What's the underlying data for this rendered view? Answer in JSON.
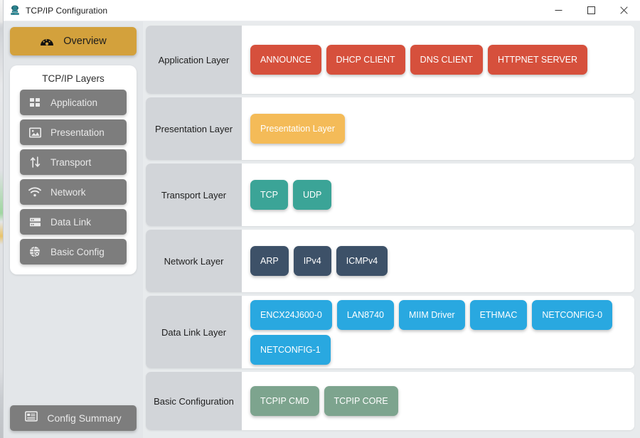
{
  "window": {
    "title": "TCP/IP Configuration",
    "icon": "network-stack-icon",
    "controls": {
      "minimize": "minimize-icon",
      "maximize": "maximize-icon",
      "close": "close-icon"
    }
  },
  "sidebar": {
    "overview": {
      "label": "Overview",
      "icon": "dashboard-gauge-icon",
      "color": "#d3a13c"
    },
    "layers_title": "TCP/IP Layers",
    "items": [
      {
        "label": "Application",
        "icon": "grid-squares-icon"
      },
      {
        "label": "Presentation",
        "icon": "image-picture-icon"
      },
      {
        "label": "Transport",
        "icon": "up-down-arrows-icon"
      },
      {
        "label": "Network",
        "icon": "wifi-signal-icon"
      },
      {
        "label": "Data Link",
        "icon": "server-rack-icon"
      },
      {
        "label": "Basic Config",
        "icon": "globe-gear-icon"
      }
    ],
    "summary": {
      "label": "Config Summary",
      "icon": "list-panel-icon"
    }
  },
  "main": {
    "rows": [
      {
        "label": "Application Layer",
        "color": "#d6503c",
        "chips": [
          "ANNOUNCE",
          "DHCP CLIENT",
          "DNS CLIENT",
          "HTTPNET SERVER"
        ]
      },
      {
        "label": "Presentation Layer",
        "color": "#f4bb58",
        "chips": [
          "Presentation Layer"
        ]
      },
      {
        "label": "Transport Layer",
        "color": "#3ba497",
        "chips": [
          "TCP",
          "UDP"
        ]
      },
      {
        "label": "Network Layer",
        "color": "#3d5168",
        "chips": [
          "ARP",
          "IPv4",
          "ICMPv4"
        ]
      },
      {
        "label": "Data Link Layer",
        "color": "#29a8e0",
        "chips": [
          "ENCX24J600-0",
          "LAN8740",
          "MIIM Driver",
          "ETHMAC",
          "NETCONFIG-0",
          "NETCONFIG-1"
        ]
      },
      {
        "label": "Basic Configuration",
        "color": "#7da48e",
        "chips": [
          "TCPIP CMD",
          "TCPIP CORE"
        ]
      }
    ]
  }
}
